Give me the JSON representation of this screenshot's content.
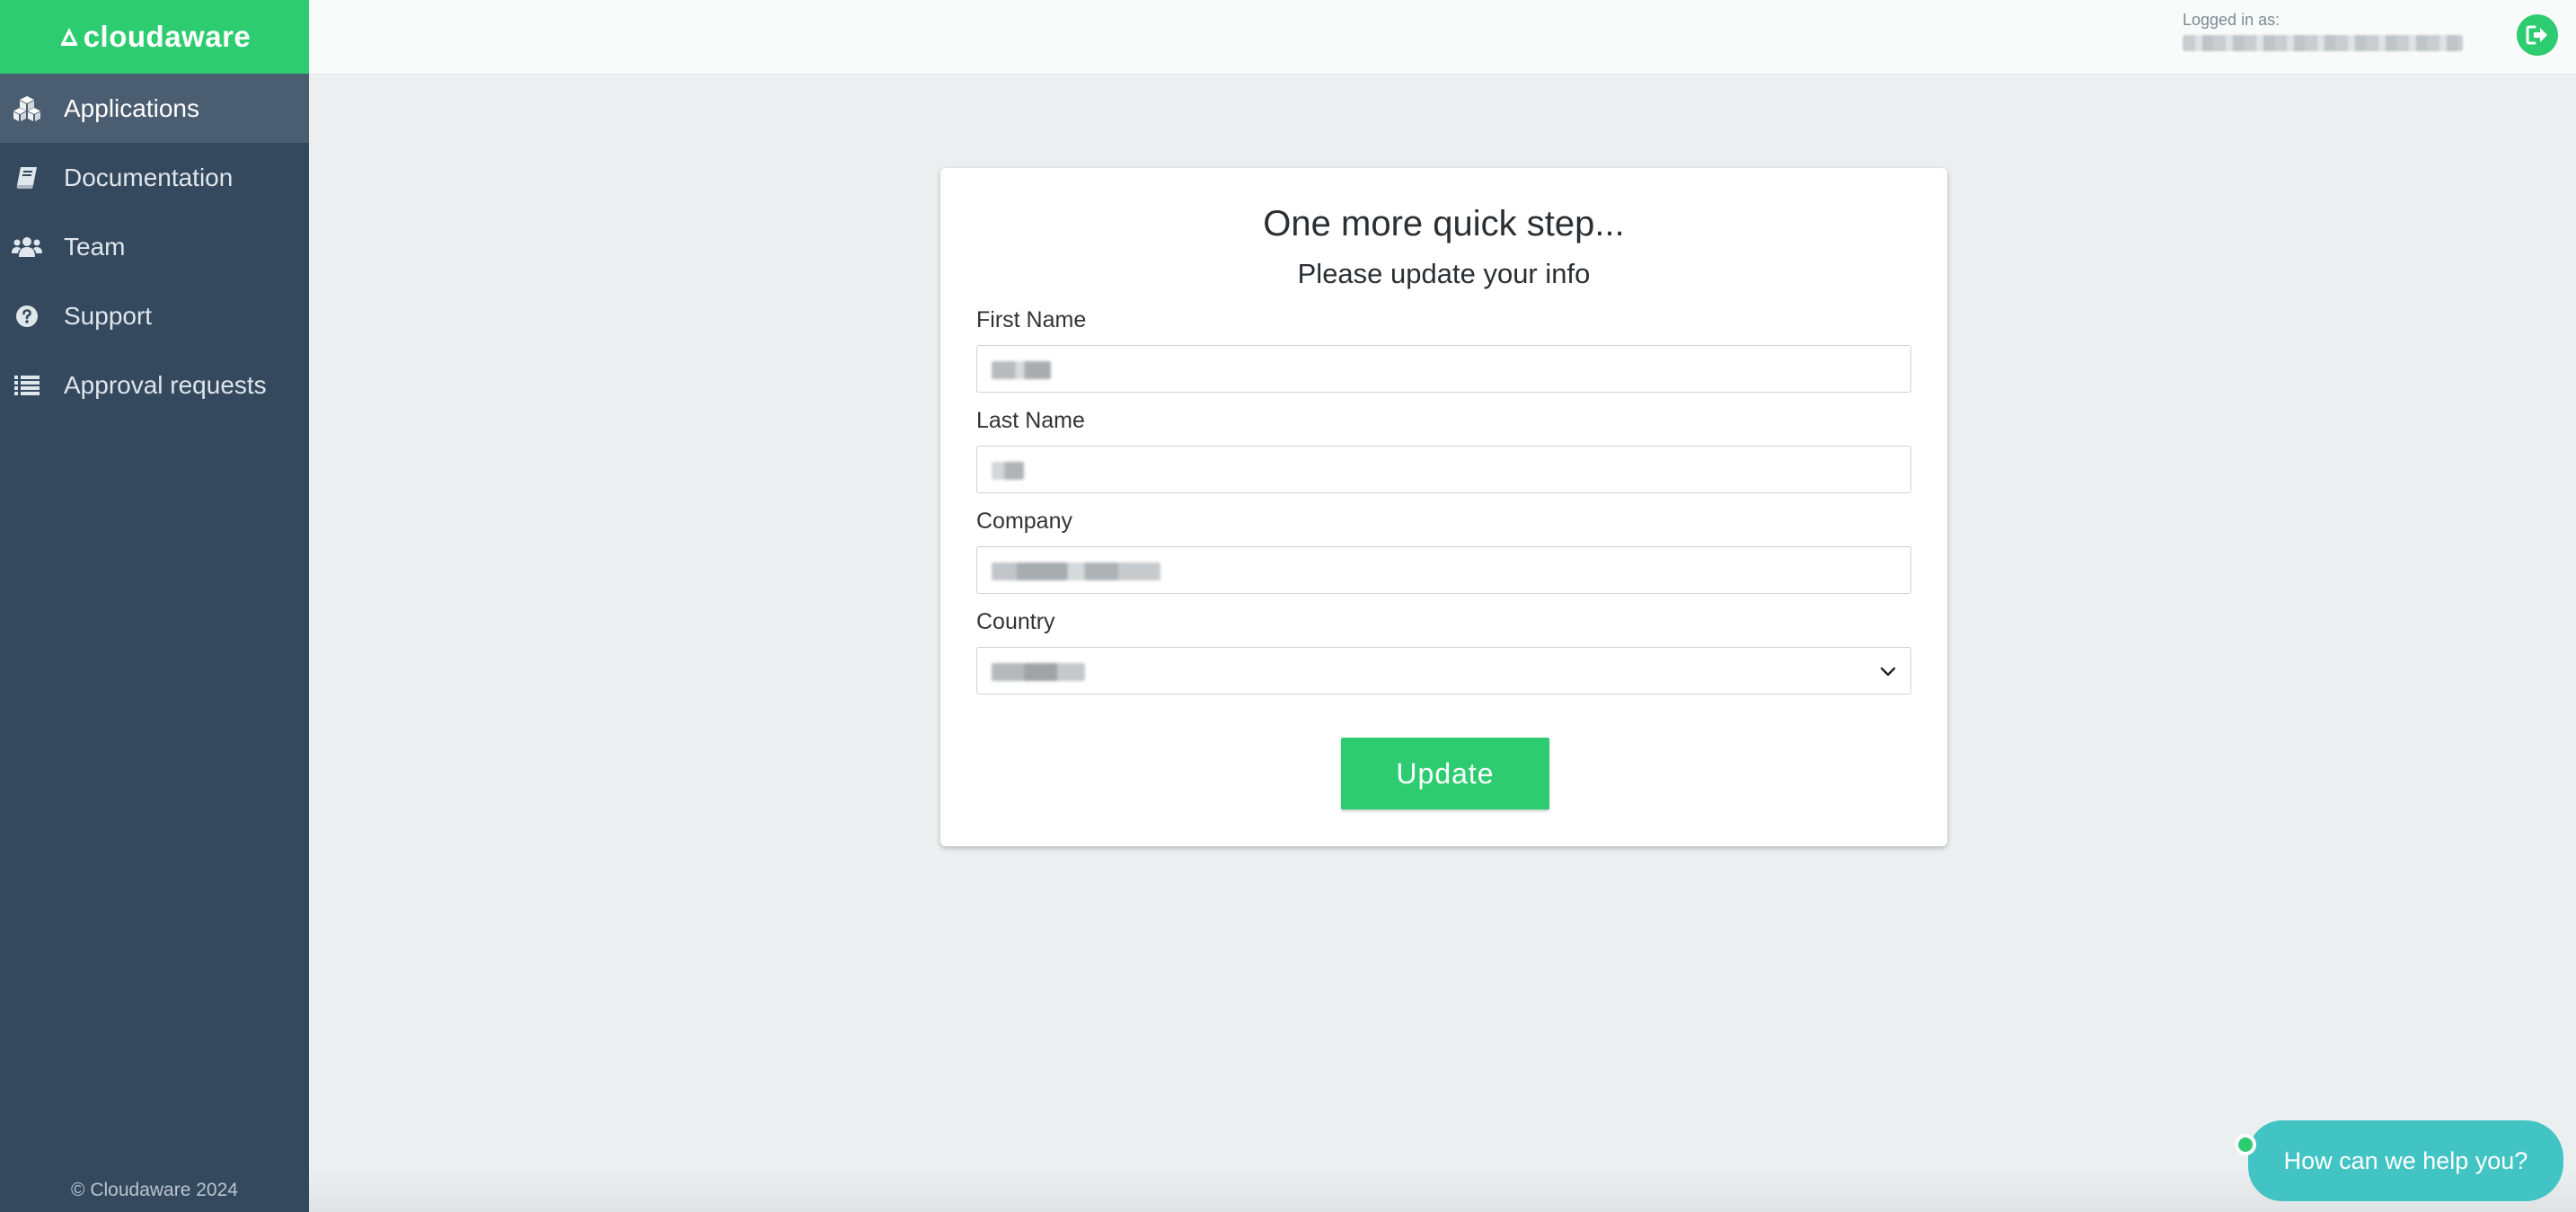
{
  "brand": {
    "name": "cloudaware",
    "color": "#2ecc71"
  },
  "sidebar": {
    "items": [
      {
        "label": "Applications",
        "icon": "cubes-icon",
        "active": true
      },
      {
        "label": "Documentation",
        "icon": "book-icon",
        "active": false
      },
      {
        "label": "Team",
        "icon": "users-icon",
        "active": false
      },
      {
        "label": "Support",
        "icon": "question-circle-icon",
        "active": false
      },
      {
        "label": "Approval requests",
        "icon": "list-icon",
        "active": false
      }
    ],
    "copyright": "© Cloudaware 2024"
  },
  "header": {
    "logged_in_label": "Logged in as:",
    "logout_icon": "sign-out-icon"
  },
  "form": {
    "title": "One more quick step...",
    "subtitle": "Please update your info",
    "fields": {
      "first_name": {
        "label": "First Name"
      },
      "last_name": {
        "label": "Last Name"
      },
      "company": {
        "label": "Company"
      },
      "country": {
        "label": "Country"
      }
    },
    "submit_label": "Update"
  },
  "help": {
    "label": "How can we help you?"
  },
  "colors": {
    "accent": "#2ecc71",
    "sidebar_bg": "#34495e",
    "help_bg": "#43c4c4"
  }
}
